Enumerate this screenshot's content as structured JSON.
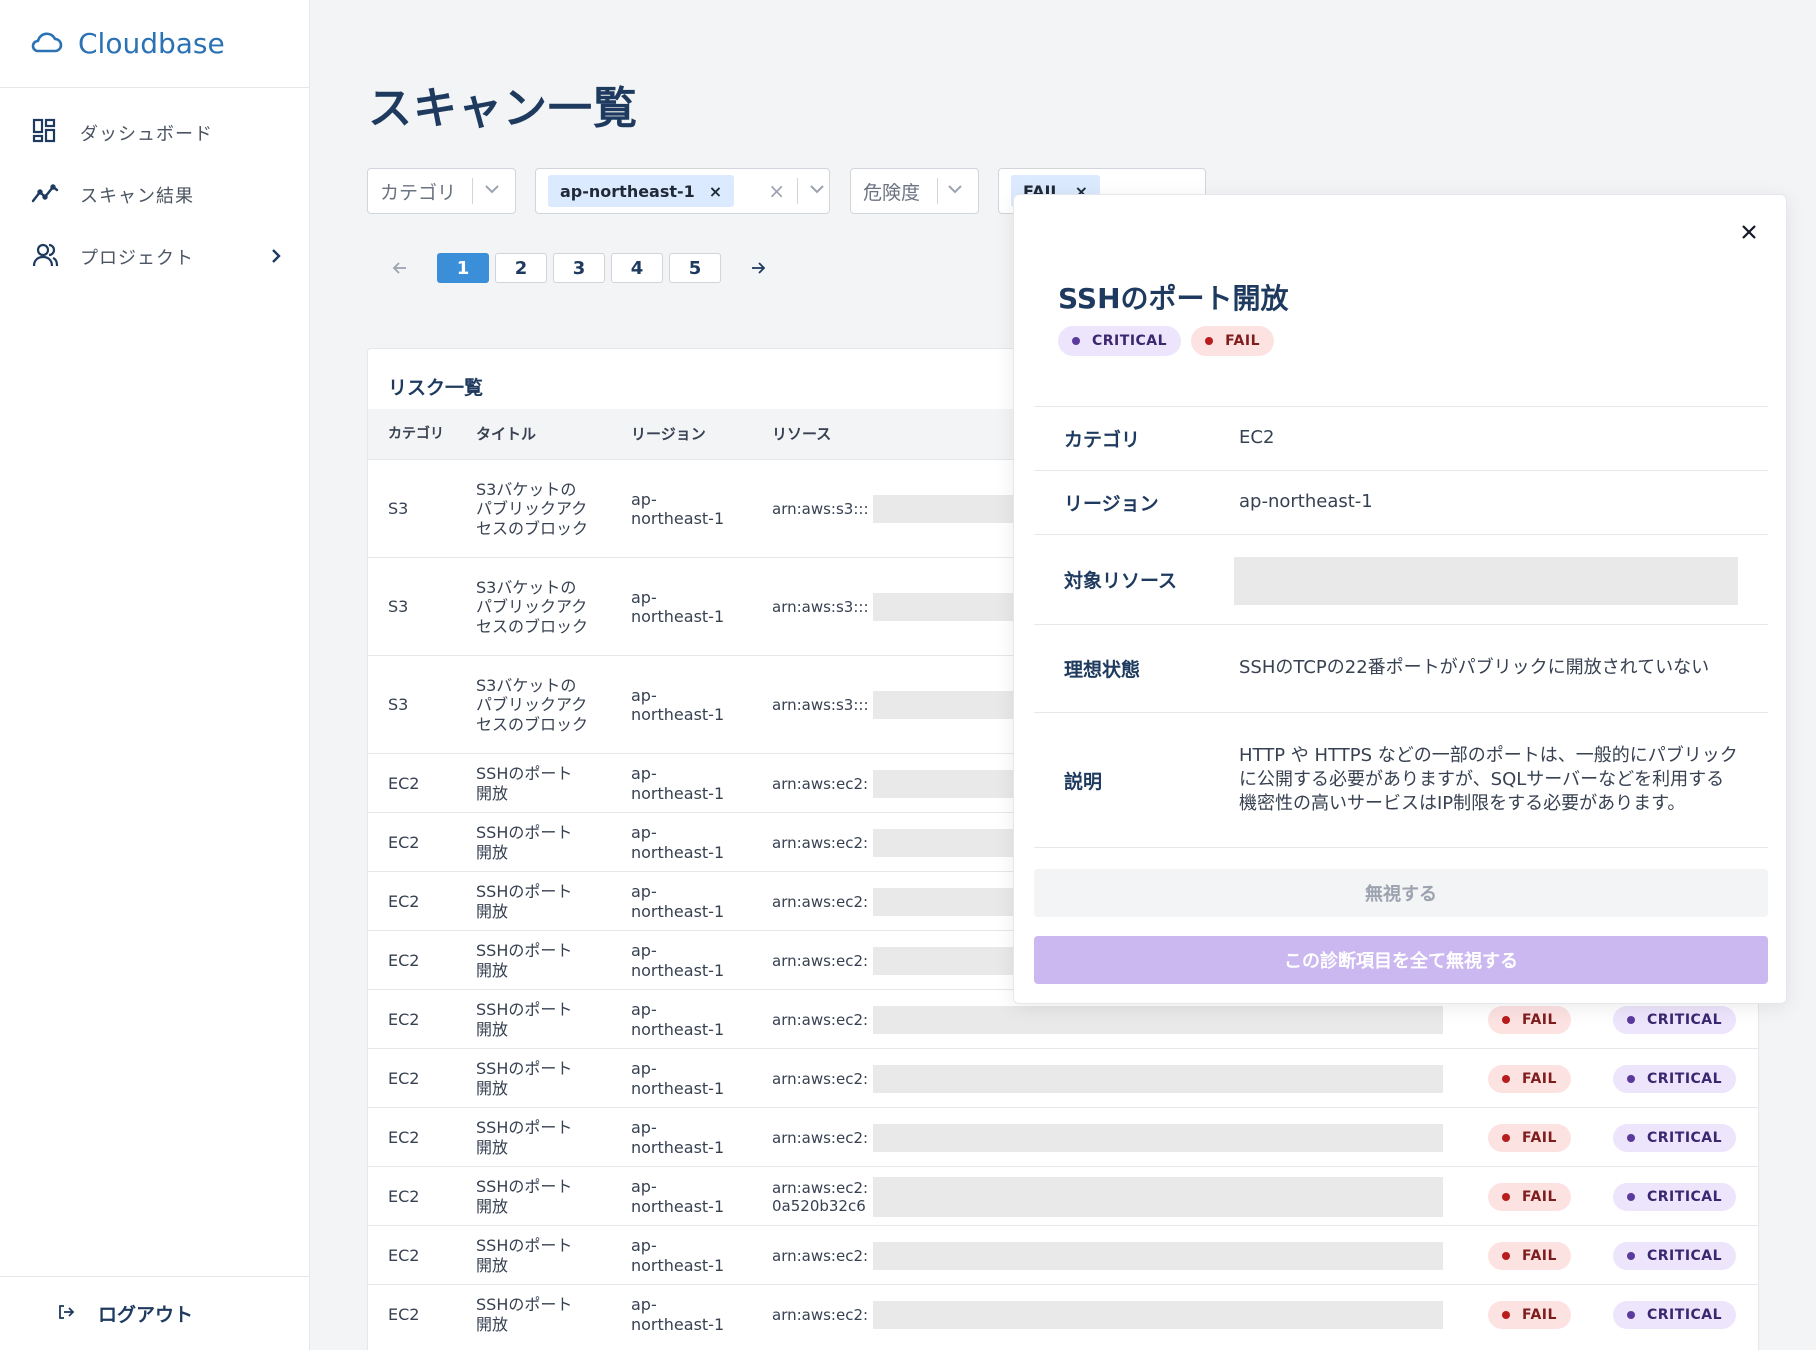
{
  "app": {
    "name": "Cloudbase",
    "accent": "#2b72b5"
  },
  "sidebar": {
    "items": [
      {
        "label": "ダッシュボード",
        "icon": "dashboard-icon"
      },
      {
        "label": "スキャン結果",
        "icon": "chart-line-icon"
      },
      {
        "label": "プロジェクト",
        "icon": "users-icon",
        "has_children": true
      }
    ],
    "logout_label": "ログアウト"
  },
  "page": {
    "title": "スキャン一覧"
  },
  "filters": {
    "category_placeholder": "カテゴリ",
    "region_value": "ap-northeast-1",
    "severity_placeholder": "危険度",
    "status_value": "FAIL"
  },
  "pagination": {
    "pages": [
      "1",
      "2",
      "3",
      "4",
      "5"
    ],
    "current": "1"
  },
  "table": {
    "title": "リスク一覧",
    "headers": {
      "category": "カテゴリ",
      "title": "タイトル",
      "region": "リージョン",
      "resource": "リソース"
    },
    "rows": [
      {
        "category": "S3",
        "title": "S3バケットのパブリックアクセスのブロック",
        "region": "ap-northeast-1",
        "resource": "arn:aws:s3:::"
      },
      {
        "category": "S3",
        "title": "S3バケットのパブリックアクセスのブロック",
        "region": "ap-northeast-1",
        "resource": "arn:aws:s3:::"
      },
      {
        "category": "S3",
        "title": "S3バケットのパブリックアクセスのブロック",
        "region": "ap-northeast-1",
        "resource": "arn:aws:s3:::"
      },
      {
        "category": "EC2",
        "title": "SSHのポート開放",
        "region": "ap-northeast-1",
        "resource": "arn:aws:ec2:"
      },
      {
        "category": "EC2",
        "title": "SSHのポート開放",
        "region": "ap-northeast-1",
        "resource": "arn:aws:ec2:"
      },
      {
        "category": "EC2",
        "title": "SSHのポート開放",
        "region": "ap-northeast-1",
        "resource": "arn:aws:ec2:"
      },
      {
        "category": "EC2",
        "title": "SSHのポート開放",
        "region": "ap-northeast-1",
        "resource": "arn:aws:ec2:"
      },
      {
        "category": "EC2",
        "title": "SSHのポート開放",
        "region": "ap-northeast-1",
        "resource": "arn:aws:ec2:",
        "status": "FAIL",
        "severity": "CRITICAL"
      },
      {
        "category": "EC2",
        "title": "SSHのポート開放",
        "region": "ap-northeast-1",
        "resource": "arn:aws:ec2:",
        "status": "FAIL",
        "severity": "CRITICAL"
      },
      {
        "category": "EC2",
        "title": "SSHのポート開放",
        "region": "ap-northeast-1",
        "resource": "arn:aws:ec2:",
        "status": "FAIL",
        "severity": "CRITICAL"
      },
      {
        "category": "EC2",
        "title": "SSHのポート開放",
        "region": "ap-northeast-1",
        "resource": "arn:aws:ec2:\n0a520b32c6",
        "status": "FAIL",
        "severity": "CRITICAL"
      },
      {
        "category": "EC2",
        "title": "SSHのポート開放",
        "region": "ap-northeast-1",
        "resource": "arn:aws:ec2:",
        "status": "FAIL",
        "severity": "CRITICAL"
      },
      {
        "category": "EC2",
        "title": "SSHのポート開放",
        "region": "ap-northeast-1",
        "resource": "arn:aws:ec2:",
        "status": "FAIL",
        "severity": "CRITICAL"
      }
    ]
  },
  "detail": {
    "title": "SSHのポート開放",
    "severity": "CRITICAL",
    "status": "FAIL",
    "fields": {
      "category_label": "カテゴリ",
      "category_value": "EC2",
      "region_label": "リージョン",
      "region_value": "ap-northeast-1",
      "resource_label": "対象リソース",
      "ideal_label": "理想状態",
      "ideal_value": "SSHのTCPの22番ポートがパブリックに開放されていない",
      "desc_label": "説明",
      "desc_value": "HTTP や HTTPS などの一部のポートは、一般的にパブリックに公開する必要がありますが、SQLサーバーなどを利用する機密性の高いサービスはIP制限をする必要があります。"
    },
    "ignore_label": "無視する",
    "ignore_all_label": "この診断項目を全て無視する"
  },
  "colors": {
    "fail_bg": "#fde2e2",
    "critical_bg": "#ede5fb",
    "primary": "#3b8fd8"
  }
}
